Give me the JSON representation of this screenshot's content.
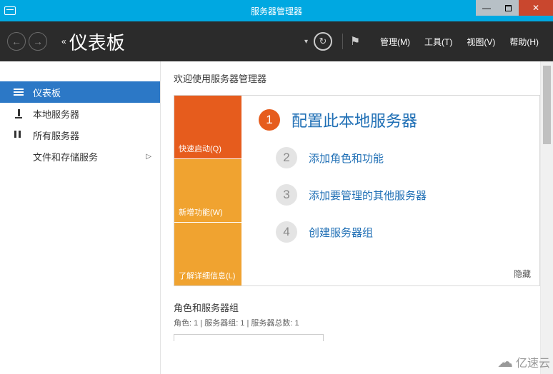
{
  "window": {
    "title": "服务器管理器"
  },
  "toolbar": {
    "back_glyph": "«",
    "page_title": "仪表板",
    "menus": {
      "manage": "管理(M)",
      "tools": "工具(T)",
      "view": "视图(V)",
      "help": "帮助(H)"
    }
  },
  "sidebar": {
    "items": [
      {
        "label": "仪表板",
        "icon": "dashboard",
        "active": true,
        "expandable": false
      },
      {
        "label": "本地服务器",
        "icon": "local",
        "active": false,
        "expandable": false
      },
      {
        "label": "所有服务器",
        "icon": "all",
        "active": false,
        "expandable": false
      },
      {
        "label": "文件和存储服务",
        "icon": "storage",
        "active": false,
        "expandable": true
      }
    ]
  },
  "main": {
    "welcome": "欢迎使用服务器管理器",
    "leftbox": {
      "b1": "快速启动(Q)",
      "b2": "新增功能(W)",
      "b3": "了解详细信息(L)"
    },
    "steps": [
      {
        "n": "1",
        "text": "配置此本地服务器",
        "primary": true
      },
      {
        "n": "2",
        "text": "添加角色和功能",
        "primary": false
      },
      {
        "n": "3",
        "text": "添加要管理的其他服务器",
        "primary": false
      },
      {
        "n": "4",
        "text": "创建服务器组",
        "primary": false
      }
    ],
    "hide": "隐藏",
    "groups_title": "角色和服务器组",
    "groups_counts": "角色: 1 | 服务器组: 1 | 服务器总数: 1"
  },
  "watermark": "亿速云"
}
